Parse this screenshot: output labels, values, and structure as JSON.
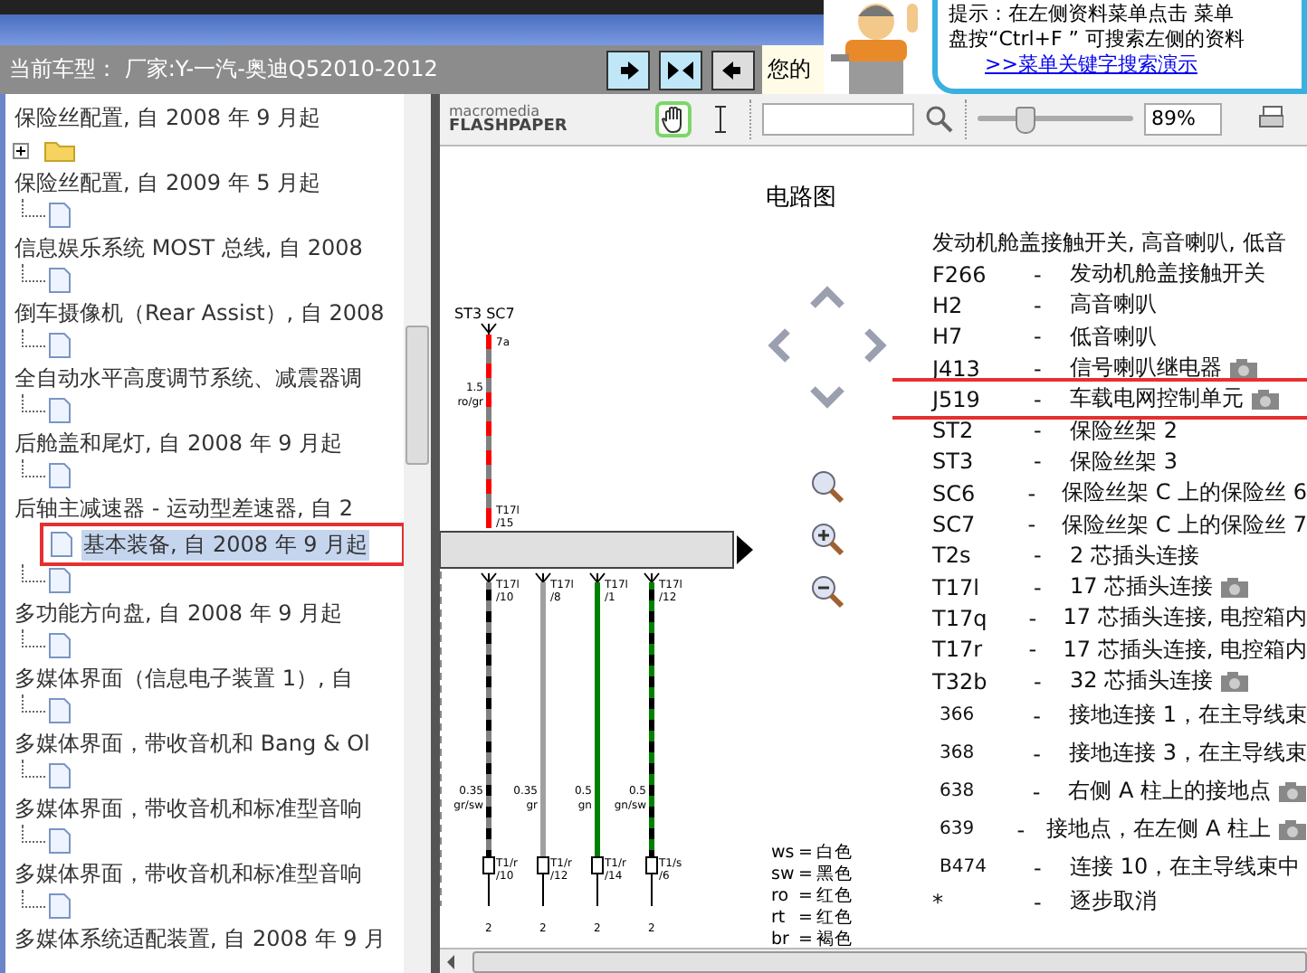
{
  "header": {
    "car_model": "当前车型： 厂家:Y-一汽-奥迪Q52010-2012",
    "buttons": [
      {
        "kind": "next",
        "selected": true
      },
      {
        "kind": "collapse",
        "selected": true
      },
      {
        "kind": "prev",
        "selected": false
      }
    ],
    "greeting": "您的"
  },
  "tip": {
    "lines": [
      "提示：在左侧资料菜单点击 菜单",
      "盘按“Ctrl+F ” 可搜索左侧的资料"
    ],
    "link": ">>菜单关键字搜索演示"
  },
  "tree": {
    "rows": [
      {
        "kind": "label",
        "text": "保险丝配置, 自 2008 年 9 月起",
        "selected": false
      },
      {
        "kind": "folder",
        "expanded": false,
        "selected": false
      },
      {
        "kind": "label",
        "text": "保险丝配置, 自 2009 年 5 月起",
        "selected": false
      },
      {
        "kind": "file",
        "selected": false
      },
      {
        "kind": "label",
        "text": "信息娱乐系统 MOST 总线, 自 2008",
        "selected": false
      },
      {
        "kind": "file",
        "selected": false
      },
      {
        "kind": "label",
        "text": "倒车摄像机（Rear Assist）, 自 2008",
        "selected": false
      },
      {
        "kind": "file",
        "selected": false
      },
      {
        "kind": "label",
        "text": "全自动水平高度调节系统、减震器调",
        "selected": false
      },
      {
        "kind": "file",
        "selected": false
      },
      {
        "kind": "label",
        "text": "后舱盖和尾灯, 自 2008 年 9 月起",
        "selected": false
      },
      {
        "kind": "file",
        "selected": false
      },
      {
        "kind": "label",
        "text": "后轴主减速器 - 运动型差速器, 自 2",
        "selected": false
      },
      {
        "kind": "file",
        "text": "基本装备, 自 2008 年 9 月起",
        "selected": true,
        "annotated": true
      },
      {
        "kind": "file",
        "selected": false
      },
      {
        "kind": "label",
        "text": "多功能方向盘, 自 2008 年 9 月起",
        "selected": false
      },
      {
        "kind": "file",
        "selected": false
      },
      {
        "kind": "label",
        "text": "多媒体界面（信息电子装置 1）, 自",
        "selected": false
      },
      {
        "kind": "file",
        "selected": false
      },
      {
        "kind": "label",
        "text": "多媒体界面，带收音机和 Bang & Ol",
        "selected": false
      },
      {
        "kind": "file",
        "selected": false
      },
      {
        "kind": "label",
        "text": "多媒体界面，带收音机和标准型音响",
        "selected": false
      },
      {
        "kind": "file",
        "selected": false
      },
      {
        "kind": "label",
        "text": "多媒体界面，带收音机和标准型音响",
        "selected": false
      },
      {
        "kind": "file",
        "selected": false
      },
      {
        "kind": "label",
        "text": "多媒体系统适配装置, 自 2008 年 9 月",
        "selected": false
      }
    ]
  },
  "viewer": {
    "logo_top": "macromedia",
    "logo_bottom": "FLASHPAPER",
    "tools": [
      {
        "kind": "hand",
        "selected": true
      },
      {
        "kind": "text",
        "selected": false
      }
    ],
    "zoom": {
      "level": 0.3,
      "value": "89%"
    }
  },
  "diagram": {
    "title": "电路图",
    "source": {
      "label": "ST3 SC7",
      "pin": "7a",
      "size": "1.5",
      "code": "ro/gr",
      "conn": "T17l",
      "conn_pin": "/15",
      "color": "#ff0000",
      "kind": "gray-stripe"
    },
    "wires": [
      {
        "conn": "T17l",
        "conn_pin": "/10",
        "size": "0.35",
        "code": "gr/sw",
        "plug": "T1/r",
        "plug_pin": "/10",
        "end": "2",
        "color": "#808080",
        "kind": "black-stripe"
      },
      {
        "conn": "T17l",
        "conn_pin": "/8",
        "size": "0.35",
        "code": "gr",
        "plug": "T1/r",
        "plug_pin": "/12",
        "end": "2",
        "color": "#a0a0a0",
        "kind": "solid"
      },
      {
        "conn": "T17l",
        "conn_pin": "/1",
        "size": "0.5",
        "code": "gn",
        "plug": "T1/r",
        "plug_pin": "/14",
        "end": "2",
        "color": "#008000",
        "kind": "solid"
      },
      {
        "conn": "T17l",
        "conn_pin": "/12",
        "size": "0.5",
        "code": "gn/sw",
        "plug": "T1/s",
        "plug_pin": "/6",
        "end": "2",
        "color": "#008000",
        "kind": "black-stripe"
      }
    ],
    "colors": [
      {
        "code": "ws",
        "eq": "=",
        "name": "白色"
      },
      {
        "code": "sw",
        "eq": "=",
        "name": "黑色"
      },
      {
        "code": "ro",
        "eq": "=",
        "name": "红色"
      },
      {
        "code": "rt",
        "eq": "=",
        "name": "红色"
      },
      {
        "code": "br",
        "eq": "=",
        "name": "褐色"
      }
    ]
  },
  "legend": {
    "title": "发动机舱盖接触开关, 高音喇叭, 低音",
    "rows": [
      {
        "kind": "part",
        "code": "F266",
        "dash": "-",
        "text": "发动机舱盖接触开关",
        "camera": false
      },
      {
        "kind": "part",
        "code": "H2",
        "dash": "-",
        "text": "高音喇叭",
        "camera": false
      },
      {
        "kind": "part",
        "code": "H7",
        "dash": "-",
        "text": "低音喇叭",
        "camera": false
      },
      {
        "kind": "part",
        "code": "J413",
        "dash": "-",
        "text": "信号喇叭继电器",
        "camera": true
      },
      {
        "kind": "part",
        "code": "J519",
        "dash": "-",
        "text": "车载电网控制单元",
        "camera": true,
        "annotated": true
      },
      {
        "kind": "part",
        "code": "ST2",
        "dash": "-",
        "text": "保险丝架 2",
        "camera": false
      },
      {
        "kind": "part",
        "code": "ST3",
        "dash": "-",
        "text": "保险丝架 3",
        "camera": false
      },
      {
        "kind": "part",
        "code": "SC6",
        "dash": "-",
        "text": "保险丝架 C 上的保险丝 6",
        "camera": false
      },
      {
        "kind": "part",
        "code": "SC7",
        "dash": "-",
        "text": "保险丝架 C 上的保险丝 7",
        "camera": false
      },
      {
        "kind": "part",
        "code": "T2s",
        "dash": "-",
        "text": "2 芯插头连接",
        "camera": false
      },
      {
        "kind": "part",
        "code": "T17l",
        "dash": "-",
        "text": "17 芯插头连接",
        "camera": true
      },
      {
        "kind": "part",
        "code": "T17q",
        "dash": "-",
        "text": "17 芯插头连接, 电控箱内",
        "camera": false
      },
      {
        "kind": "part",
        "code": "T17r",
        "dash": "-",
        "text": "17 芯插头连接, 电控箱内",
        "camera": false
      },
      {
        "kind": "part",
        "code": "T32b",
        "dash": "-",
        "text": "32 芯插头连接",
        "camera": true
      },
      {
        "kind": "ground",
        "code": "366",
        "dash": "-",
        "text": "接地连接 1，在主导线束",
        "camera": false
      },
      {
        "kind": "ground",
        "code": "368",
        "dash": "-",
        "text": "接地连接 3，在主导线束",
        "camera": false
      },
      {
        "kind": "ground",
        "code": "638",
        "dash": "-",
        "text": "右侧 A 柱上的接地点",
        "camera": true
      },
      {
        "kind": "ground",
        "code": "639",
        "dash": "-",
        "text": "接地点，在左侧 A 柱上",
        "camera": true
      },
      {
        "kind": "ground",
        "code": "B474",
        "dash": "-",
        "text": "连接 10，在主导线束中",
        "camera": false
      },
      {
        "kind": "part",
        "code": "*",
        "dash": "-",
        "text": "逐步取消",
        "camera": false
      }
    ]
  }
}
